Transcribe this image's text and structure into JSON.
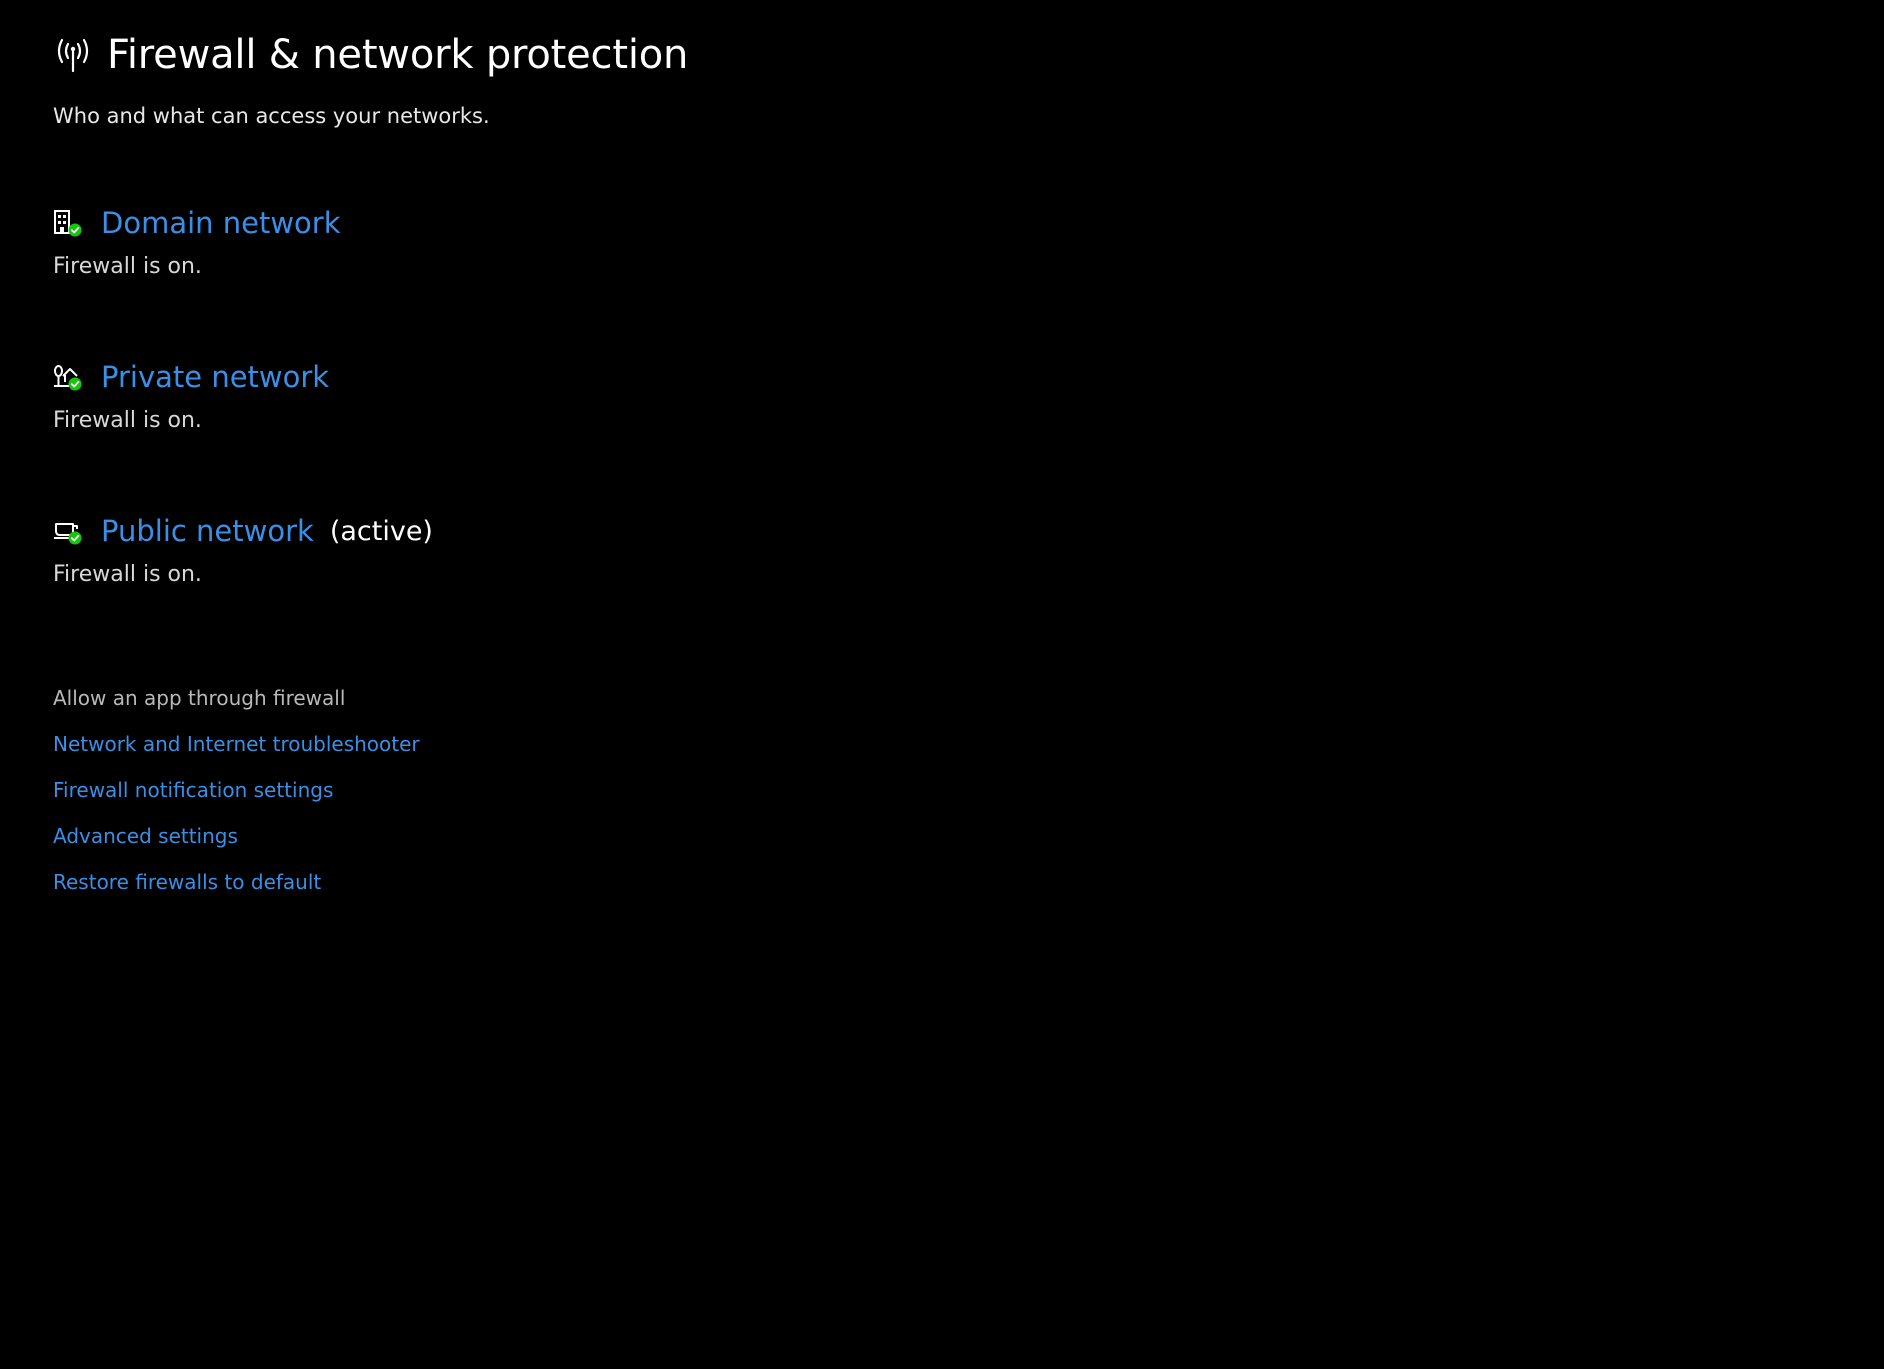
{
  "header": {
    "icon": "antenna-icon",
    "title": "Firewall & network protection",
    "subtitle": "Who and what can access your networks."
  },
  "networks": [
    {
      "icon": "domain-building-check-icon",
      "name": "Domain network",
      "active_label": "",
      "status": "Firewall is on."
    },
    {
      "icon": "private-home-check-icon",
      "name": "Private network",
      "active_label": "",
      "status": "Firewall is on."
    },
    {
      "icon": "public-coffee-check-icon",
      "name": "Public network",
      "active_label": "(active)",
      "status": "Firewall is on."
    }
  ],
  "links": [
    {
      "label": "Allow an app through firewall",
      "style": "disabled"
    },
    {
      "label": "Network and Internet troubleshooter",
      "style": "link"
    },
    {
      "label": "Firewall notification settings",
      "style": "link"
    },
    {
      "label": "Advanced settings",
      "style": "link"
    },
    {
      "label": "Restore firewalls to default",
      "style": "link"
    }
  ],
  "colors": {
    "background": "#000000",
    "link": "#3a8fe6",
    "status_ok": "#16c60c",
    "text": "#ffffff"
  }
}
